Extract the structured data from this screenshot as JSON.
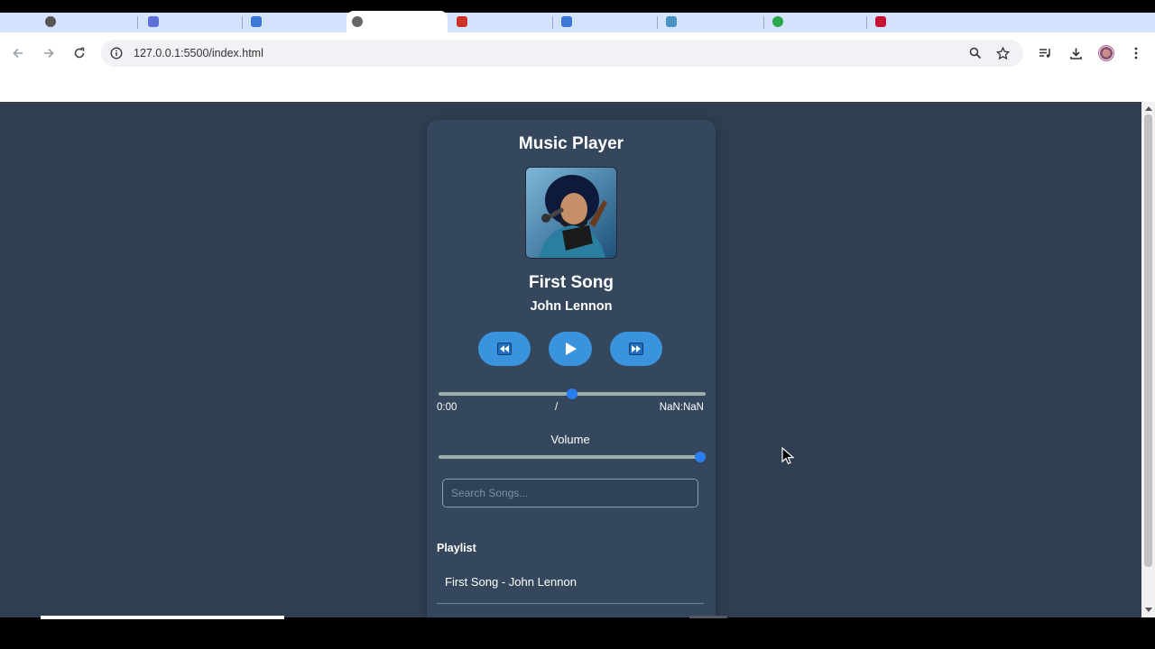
{
  "browser": {
    "address": "127.0.0.1:5500/index.html"
  },
  "player": {
    "title": "Music Player",
    "current_song": {
      "title": "First Song",
      "artist": "John Lennon"
    },
    "progress": {
      "current_time": "0:00",
      "separator": "/",
      "duration": "NaN:NaN",
      "fraction": 0.5
    },
    "volume": {
      "label": "Volume",
      "fraction": 1.0
    },
    "search": {
      "placeholder": "Search Songs..."
    },
    "playlist": {
      "title": "Playlist",
      "items": [
        "First Song - John Lennon"
      ]
    }
  },
  "colors": {
    "page_background": "#2f3e50",
    "card_background": "#34475c",
    "button_blue": "#3a93dd",
    "slider_thumb": "#2b7cf0"
  },
  "icons": [
    "rewind-icon",
    "play-icon",
    "fast-forward-icon"
  ]
}
